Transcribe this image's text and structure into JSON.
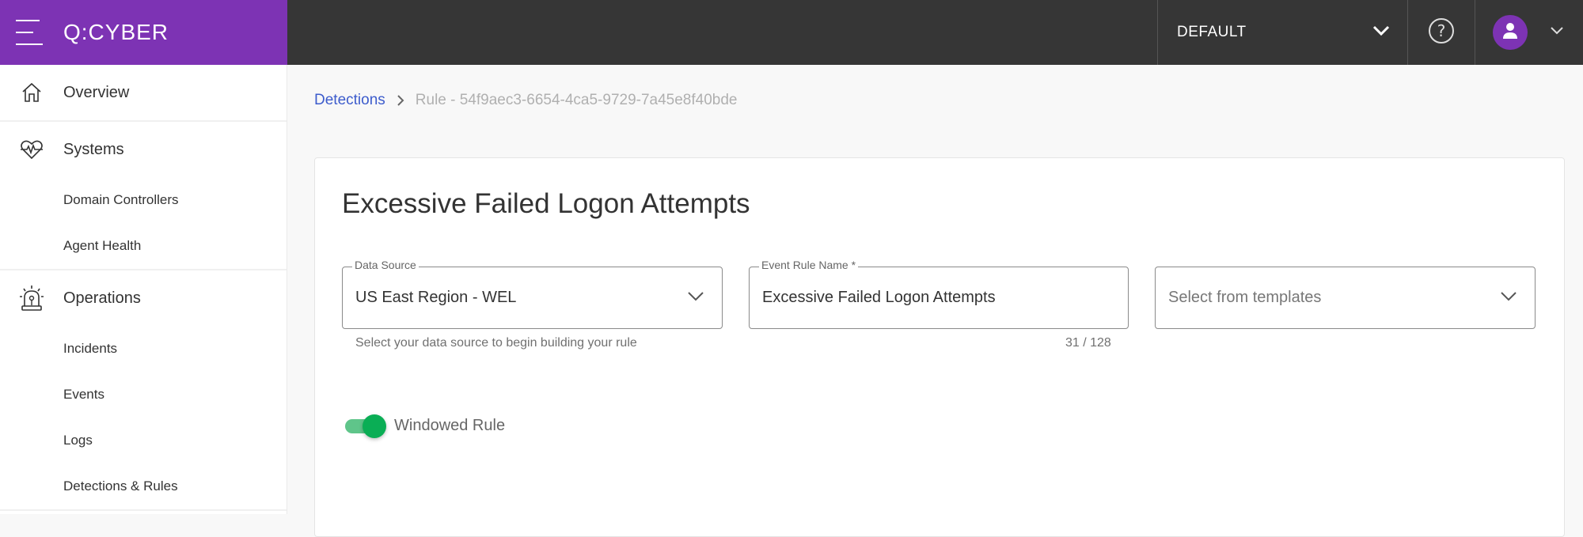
{
  "header": {
    "logo": "Q:CYBER",
    "tenant_selector": "DEFAULT",
    "icons": [
      "menu-icon",
      "chevron-down-icon",
      "help-icon",
      "user-icon",
      "chevron-down-icon"
    ]
  },
  "sidebar": {
    "groups": [
      {
        "label": "Overview",
        "icon": "home-icon",
        "items": []
      },
      {
        "label": "Systems",
        "icon": "heart-pulse-icon",
        "items": [
          "Domain Controllers",
          "Agent Health"
        ]
      },
      {
        "label": "Operations",
        "icon": "siren-icon",
        "items": [
          "Incidents",
          "Events",
          "Logs",
          "Detections & Rules"
        ]
      }
    ]
  },
  "breadcrumb": {
    "parent": "Detections",
    "current": "Rule - 54f9aec3-6654-4ca5-9729-7a45e8f40bde"
  },
  "form": {
    "title": "Excessive Failed Logon Attempts",
    "data_source": {
      "label": "Data Source",
      "value": "US East Region - WEL",
      "helper": "Select your data source to begin building your rule"
    },
    "rule_name": {
      "label": "Event Rule Name *",
      "value": "Excessive Failed Logon Attempts",
      "counter": "31 / 128"
    },
    "template": {
      "placeholder": "Select from templates"
    },
    "windowed_rule": {
      "label": "Windowed Rule",
      "enabled": true
    }
  },
  "colors": {
    "brand": "#7d33b4",
    "topbar": "#363636",
    "link": "#3d5ccc",
    "toggle_on": "#0aae55"
  }
}
